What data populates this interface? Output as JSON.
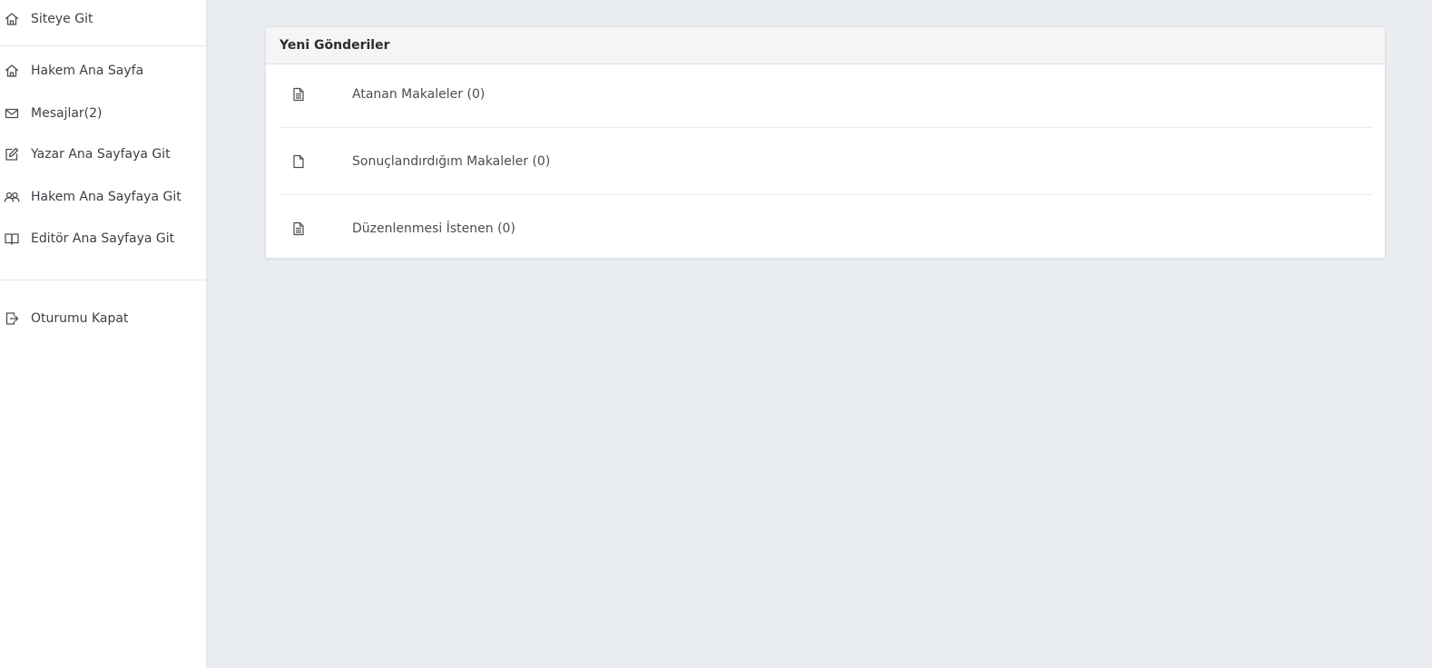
{
  "sidebar": {
    "items": [
      {
        "label": "Siteye Git",
        "icon": "home-icon"
      },
      {
        "label": "Hakem Ana Sayfa",
        "icon": "home-icon"
      },
      {
        "label": "Mesajlar(2)",
        "icon": "envelope-icon"
      },
      {
        "label": "Yazar Ana Sayfaya Git",
        "icon": "edit-icon"
      },
      {
        "label": "Hakem Ana Sayfaya Git",
        "icon": "users-icon"
      },
      {
        "label": "Editör Ana Sayfaya Git",
        "icon": "book-icon"
      },
      {
        "label": "Oturumu Kapat",
        "icon": "logout-icon"
      }
    ]
  },
  "panel": {
    "title": "Yeni Gönderiler",
    "rows": [
      {
        "label": "Atanan Makaleler (0)",
        "icon": "file-text-icon"
      },
      {
        "label": "Sonuçlandırdığım Makaleler (0)",
        "icon": "file-icon"
      },
      {
        "label": "Düzenlenmesi İstenen (0)",
        "icon": "file-text-icon"
      }
    ]
  },
  "colors": {
    "background": "#e9ecf1",
    "sidebar": "#ffffff",
    "panel_header": "#f5f5f5",
    "text": "#3c3f44"
  }
}
